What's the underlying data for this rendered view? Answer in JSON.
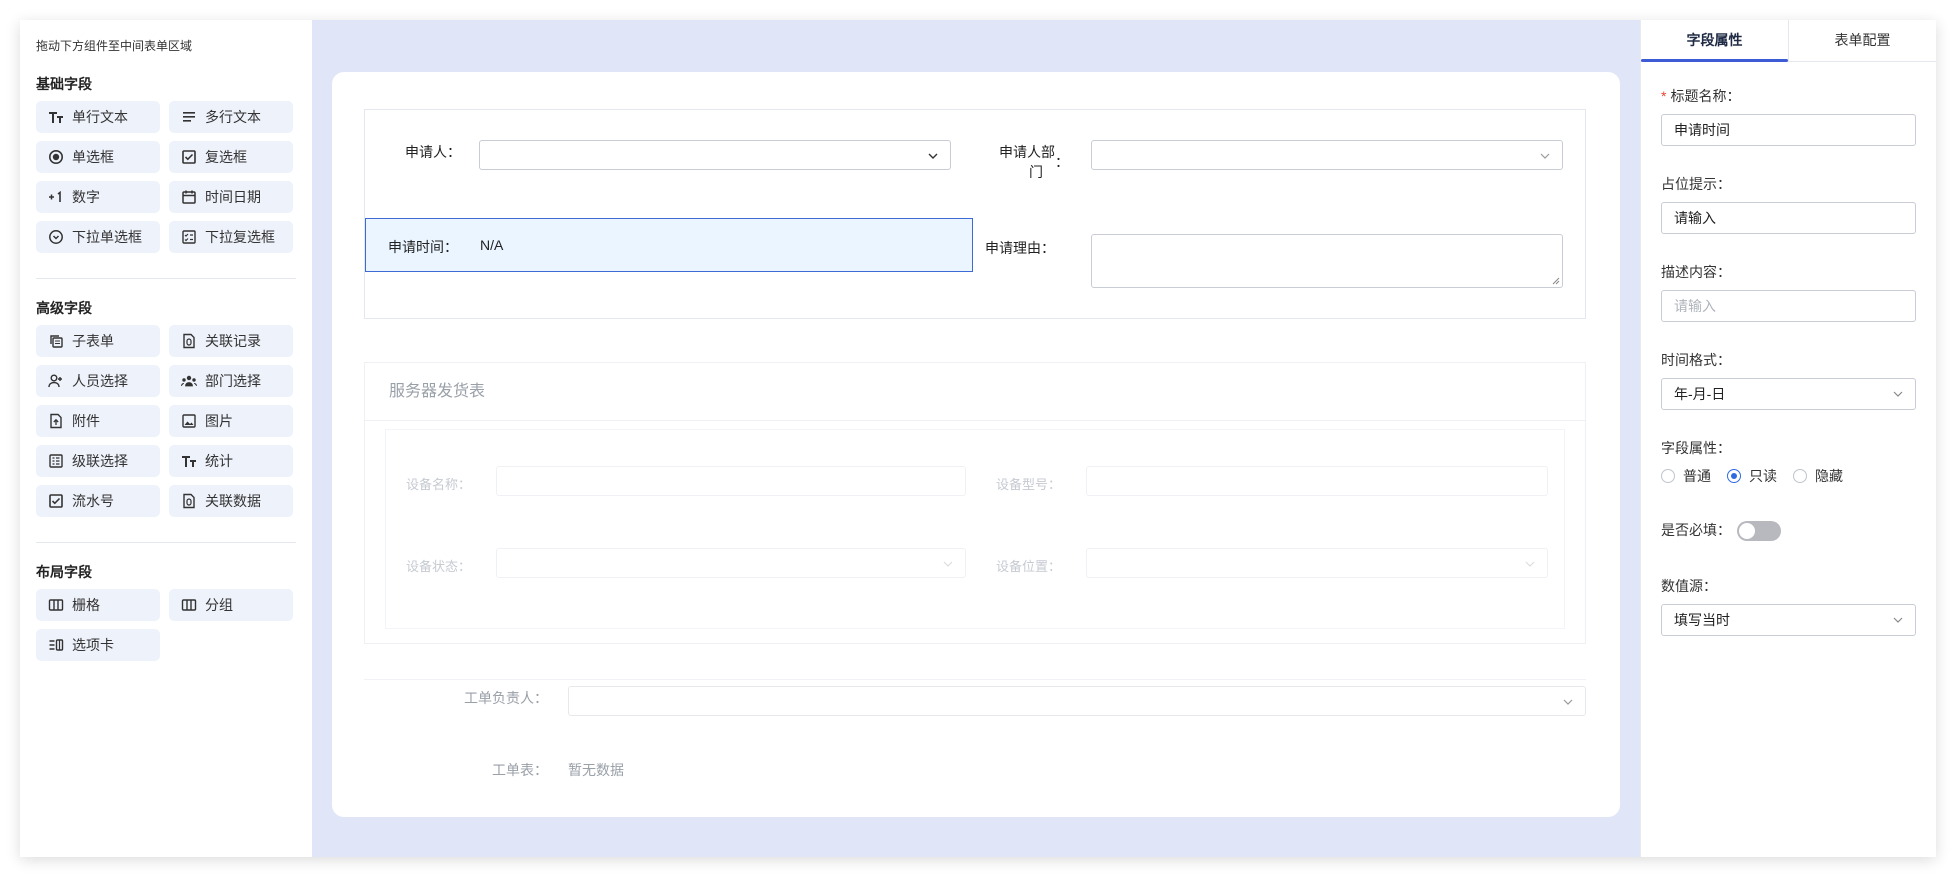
{
  "palette": {
    "hint": "拖动下方组件至中间表单区域",
    "groups": [
      {
        "title": "基础字段",
        "items": [
          {
            "label": "单行文本",
            "icon": "text-size-icon"
          },
          {
            "label": "多行文本",
            "icon": "paragraph-lines-icon"
          },
          {
            "label": "单选框",
            "icon": "radio-dot-icon"
          },
          {
            "label": "复选框",
            "icon": "checkbox-checked-icon"
          },
          {
            "label": "数字",
            "icon": "plus-one-icon"
          },
          {
            "label": "时间日期",
            "icon": "calendar-icon"
          },
          {
            "label": "下拉单选框",
            "icon": "dropdown-circle-icon"
          },
          {
            "label": "下拉复选框",
            "icon": "checklist-icon"
          }
        ]
      },
      {
        "title": "高级字段",
        "items": [
          {
            "label": "子表单",
            "icon": "copy-stack-icon"
          },
          {
            "label": "关联记录",
            "icon": "linked-doc-icon"
          },
          {
            "label": "人员选择",
            "icon": "person-add-icon"
          },
          {
            "label": "部门选择",
            "icon": "group-icon"
          },
          {
            "label": "附件",
            "icon": "file-upload-icon"
          },
          {
            "label": "图片",
            "icon": "image-icon"
          },
          {
            "label": "级联选择",
            "icon": "cascade-list-icon"
          },
          {
            "label": "统计",
            "icon": "text-size-icon"
          },
          {
            "label": "流水号",
            "icon": "checkbox-checked-icon"
          },
          {
            "label": "关联数据",
            "icon": "linked-doc-icon"
          }
        ]
      },
      {
        "title": "布局字段",
        "items": [
          {
            "label": "栅格",
            "icon": "grid-columns-icon"
          },
          {
            "label": "分组",
            "icon": "grid-columns-icon"
          },
          {
            "label": "选项卡",
            "icon": "tabs-layout-icon"
          }
        ]
      }
    ]
  },
  "form": {
    "applicant_label": "申请人：",
    "department_label_line1": "申请人部",
    "department_label_line2": "门",
    "department_colon": "：",
    "apply_time_label": "申请时间：",
    "apply_time_value": "N/A",
    "reason_label": "申请理由：",
    "subform_title": "服务器发货表",
    "device_name_label": "设备名称：",
    "device_model_label": "设备型号：",
    "device_status_label": "设备状态：",
    "device_location_label": "设备位置：",
    "owner_label": "工单负责人：",
    "table_label": "工单表：",
    "table_empty": "暂无数据"
  },
  "props": {
    "tabs": [
      "字段属性",
      "表单配置"
    ],
    "active_tab": "字段属性",
    "title_label": "标题名称：",
    "title_value": "申请时间",
    "placeholder_label": "占位提示：",
    "placeholder_value": "请输入",
    "desc_label": "描述内容：",
    "desc_placeholder": "请输入",
    "time_format_label": "时间格式：",
    "time_format_value": "年-月-日",
    "field_attr_label": "字段属性：",
    "field_attr_options": [
      "普通",
      "只读",
      "隐藏"
    ],
    "field_attr_selected": "只读",
    "required_label": "是否必填：",
    "required_on": false,
    "source_label": "数值源：",
    "source_value": "填写当时"
  },
  "colors": {
    "accent": "#3e5bd6",
    "canvas_bg": "#e0e6f7",
    "palette_item_bg": "#eef2fb",
    "selected_field_bg": "#eaf5ff",
    "required_mark": "#f04134"
  }
}
